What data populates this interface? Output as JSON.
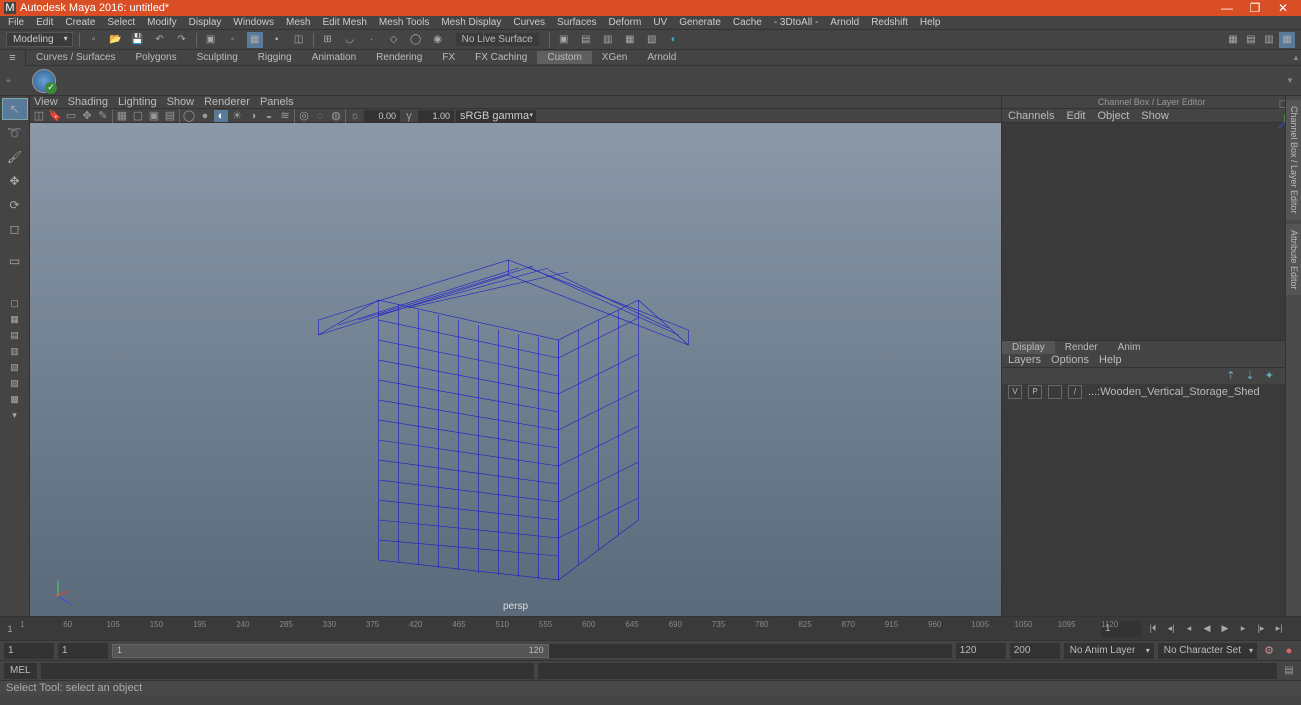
{
  "titlebar": {
    "app": "Autodesk Maya 2016: untitled*",
    "minimize": "—",
    "maximize": "❐",
    "close": "✕"
  },
  "menubar": [
    "File",
    "Edit",
    "Create",
    "Select",
    "Modify",
    "Display",
    "Windows",
    "Mesh",
    "Edit Mesh",
    "Mesh Tools",
    "Mesh Display",
    "Curves",
    "Surfaces",
    "Deform",
    "UV",
    "Generate",
    "Cache",
    "- 3DtoAll -",
    "Arnold",
    "Redshift",
    "Help"
  ],
  "workspace": "Modeling",
  "statusline": {
    "no_live_surface": "No Live Surface"
  },
  "shelf_tabs": [
    "Curves / Surfaces",
    "Polygons",
    "Sculpting",
    "Rigging",
    "Animation",
    "Rendering",
    "FX",
    "FX Caching",
    "Custom",
    "XGen",
    "Arnold"
  ],
  "shelf_active": "Custom",
  "viewport_menu": [
    "View",
    "Shading",
    "Lighting",
    "Show",
    "Renderer",
    "Panels"
  ],
  "viewport_toolbar": {
    "v1": "0.00",
    "v2": "1.00",
    "gamma_sel": "sRGB gamma"
  },
  "viewport": {
    "camera": "persp"
  },
  "channelbox": {
    "title": "Channel Box / Layer Editor",
    "top_tabs": [
      "Channels",
      "Edit",
      "Object",
      "Show"
    ],
    "bottom_tabs": [
      "Display",
      "Render",
      "Anim"
    ],
    "bottom_active": "Display",
    "bottom_menu": [
      "Layers",
      "Options",
      "Help"
    ],
    "layer_v": "V",
    "layer_p": "P",
    "layer_swatch": "/",
    "layer_name": "...:Wooden_Vertical_Storage_Shed"
  },
  "sidetabs": [
    "Channel Box / Layer Editor",
    "Attribute Editor"
  ],
  "timeline": {
    "start_marker": "1",
    "ticks": [
      "1",
      "60",
      "105",
      "150",
      "195",
      "240",
      "285",
      "330",
      "375",
      "420",
      "465",
      "510",
      "555",
      "600",
      "645",
      "690",
      "735",
      "780",
      "825",
      "870",
      "915",
      "960",
      "1005",
      "1050",
      "1095",
      "1120"
    ],
    "current_frame": "1"
  },
  "rangerow": {
    "start_outer": "1",
    "start_inner": "1",
    "slider_start": "1",
    "slider_end": "120",
    "end_inner": "120",
    "end_outer": "200",
    "anim_layer": "No Anim Layer",
    "char_set": "No Character Set"
  },
  "cmdrow": {
    "lang": "MEL"
  },
  "helpline": "Select Tool: select an object"
}
